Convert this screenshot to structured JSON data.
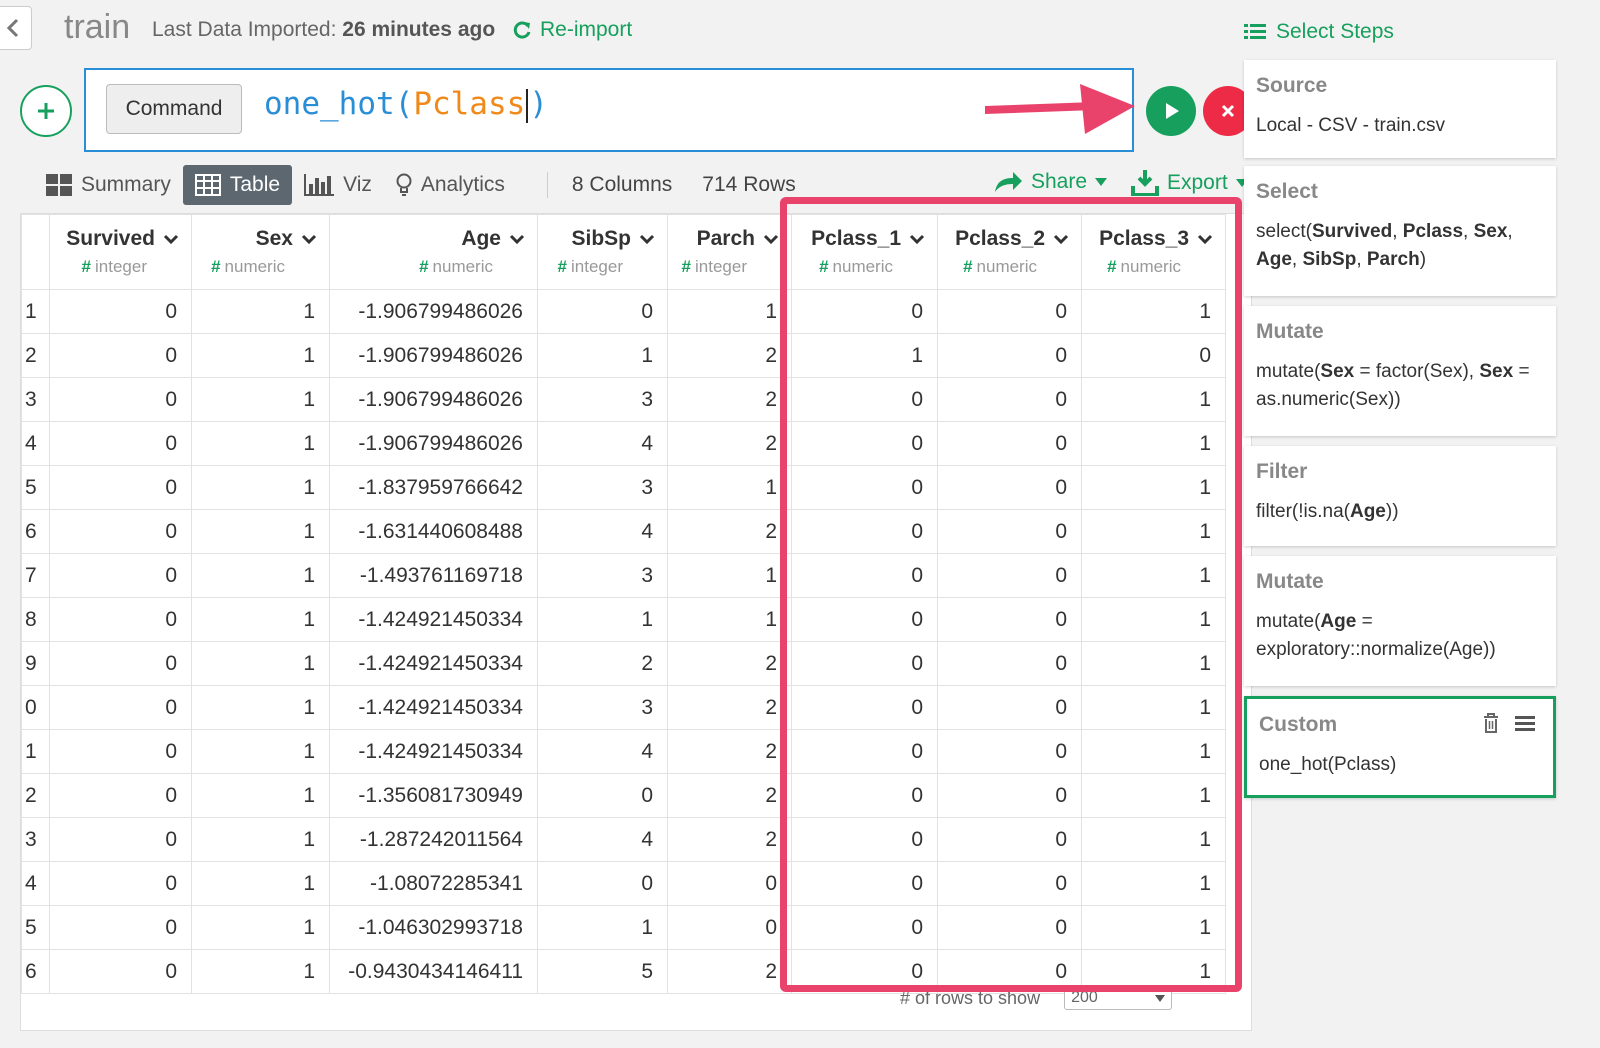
{
  "header": {
    "title": "train",
    "last_import_label": "Last Data Imported:",
    "last_import_value": "26 minutes ago",
    "reimport": "Re-import"
  },
  "command": {
    "type_label": "Command",
    "func": "one_hot(",
    "arg": "Pclass",
    "close": ")"
  },
  "view_tabs": [
    {
      "label": "Summary",
      "icon": "summary-grid-icon"
    },
    {
      "label": "Table",
      "icon": "table-icon",
      "active": true
    },
    {
      "label": "Viz",
      "icon": "bar-chart-icon"
    },
    {
      "label": "Analytics",
      "icon": "lightbulb-icon"
    }
  ],
  "counts": {
    "columns": "8",
    "columns_label": "Columns",
    "rows": "714",
    "rows_label": "Rows"
  },
  "actions": {
    "share": "Share",
    "export": "Export"
  },
  "table": {
    "columns": [
      {
        "name": "Survived",
        "type": "integer"
      },
      {
        "name": "Sex",
        "type": "numeric"
      },
      {
        "name": "Age",
        "type": "numeric"
      },
      {
        "name": "SibSp",
        "type": "integer"
      },
      {
        "name": "Parch",
        "type": "integer"
      },
      {
        "name": "Pclass_1",
        "type": "numeric"
      },
      {
        "name": "Pclass_2",
        "type": "numeric"
      },
      {
        "name": "Pclass_3",
        "type": "numeric"
      }
    ],
    "rows": [
      [
        "1",
        "0",
        "1",
        "-1.906799486026",
        "0",
        "1",
        "0",
        "0",
        "1"
      ],
      [
        "2",
        "0",
        "1",
        "-1.906799486026",
        "1",
        "2",
        "1",
        "0",
        "0"
      ],
      [
        "3",
        "0",
        "1",
        "-1.906799486026",
        "3",
        "2",
        "0",
        "0",
        "1"
      ],
      [
        "4",
        "0",
        "1",
        "-1.906799486026",
        "4",
        "2",
        "0",
        "0",
        "1"
      ],
      [
        "5",
        "0",
        "1",
        "-1.837959766642",
        "3",
        "1",
        "0",
        "0",
        "1"
      ],
      [
        "6",
        "0",
        "1",
        "-1.631440608488",
        "4",
        "2",
        "0",
        "0",
        "1"
      ],
      [
        "7",
        "0",
        "1",
        "-1.493761169718",
        "3",
        "1",
        "0",
        "0",
        "1"
      ],
      [
        "8",
        "0",
        "1",
        "-1.424921450334",
        "1",
        "1",
        "0",
        "0",
        "1"
      ],
      [
        "9",
        "0",
        "1",
        "-1.424921450334",
        "2",
        "2",
        "0",
        "0",
        "1"
      ],
      [
        "0",
        "0",
        "1",
        "-1.424921450334",
        "3",
        "2",
        "0",
        "0",
        "1"
      ],
      [
        "1",
        "0",
        "1",
        "-1.424921450334",
        "4",
        "2",
        "0",
        "0",
        "1"
      ],
      [
        "2",
        "0",
        "1",
        "-1.356081730949",
        "0",
        "2",
        "0",
        "0",
        "1"
      ],
      [
        "3",
        "0",
        "1",
        "-1.287242011564",
        "4",
        "2",
        "0",
        "0",
        "1"
      ],
      [
        "4",
        "0",
        "1",
        "-1.08072285341",
        "0",
        "0",
        "0",
        "0",
        "1"
      ],
      [
        "5",
        "0",
        "1",
        "-1.046302993718",
        "1",
        "0",
        "0",
        "0",
        "1"
      ],
      [
        "6",
        "0",
        "1",
        "-0.9430434146411",
        "5",
        "2",
        "0",
        "0",
        "1"
      ]
    ],
    "rows_to_show_label": "# of rows to show",
    "rows_to_show_value": "200"
  },
  "steps": {
    "header": "Select Steps",
    "items": [
      {
        "title": "Source",
        "body_html": "Local - CSV - train.csv"
      },
      {
        "title": "Select",
        "body_html": "select(<b>Survived</b>, <b>Pclass</b>, <b>Sex</b>, <b>Age</b>, <b>SibSp</b>, <b>Parch</b>)"
      },
      {
        "title": "Mutate",
        "body_html": "mutate(<b>Sex</b> = factor(Sex), <b>Sex</b> = as.numeric(Sex))"
      },
      {
        "title": "Filter",
        "body_html": "filter(!is.na(<b>Age</b>))"
      },
      {
        "title": "Mutate",
        "body_html": "mutate(<b>Age</b> = exploratory::normalize(Age))"
      },
      {
        "title": "Custom",
        "body_html": "one_hot(Pclass)",
        "active": true
      }
    ]
  },
  "colors": {
    "accent": "#17a05d",
    "blue": "#2a8ed6",
    "danger": "#ee2b46",
    "highlight": "#e9436b"
  }
}
